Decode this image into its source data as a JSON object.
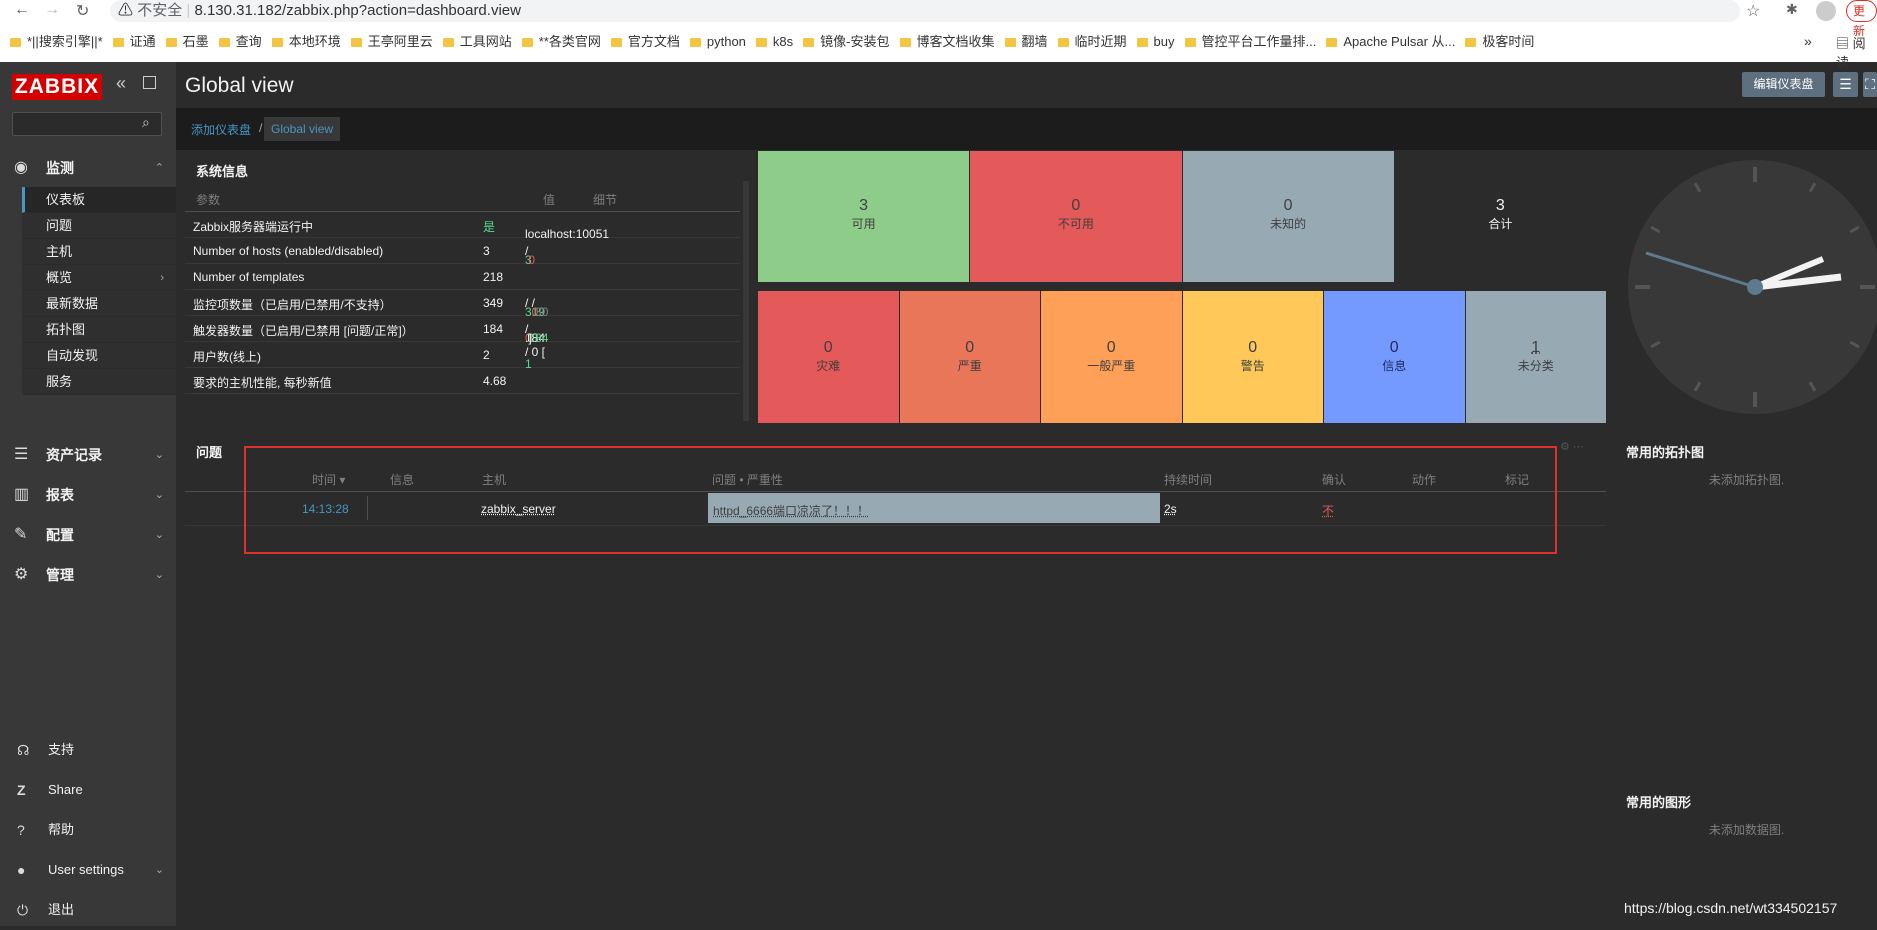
{
  "browser": {
    "insecure_label": "不安全",
    "url": "8.130.31.182/zabbix.php?action=dashboard.view",
    "bookmarks": [
      "*||搜索引擎||*",
      "证通",
      "石墨",
      "查询",
      "本地环境",
      "王亭阿里云",
      "工具网站",
      "**各类官网",
      "官方文档",
      "python",
      "k8s",
      "镜像-安装包",
      "博客文档收集",
      "翻墙",
      "临时近期",
      "buy",
      "管控平台工作量排...",
      "Apache Pulsar 从...",
      "极客时间"
    ],
    "more_label": "»",
    "reading_list": "阅读",
    "update_button": "更新"
  },
  "sidebar": {
    "logo": "ZABBIX",
    "search_placeholder": "",
    "menus": [
      {
        "label": "监测",
        "icon": "eye-icon"
      },
      {
        "label": "资产记录",
        "icon": "list-icon"
      },
      {
        "label": "报表",
        "icon": "chart-icon"
      },
      {
        "label": "配置",
        "icon": "wrench-icon"
      },
      {
        "label": "管理",
        "icon": "gear-icon"
      }
    ],
    "monitor_items": [
      "仪表板",
      "问题",
      "主机",
      "概览",
      "最新数据",
      "拓扑图",
      "自动发现",
      "服务"
    ],
    "footer": [
      "支持",
      "Share",
      "帮助",
      "User settings",
      "退出"
    ]
  },
  "header": {
    "title": "Global view",
    "edit_button": "编辑仪表盘",
    "breadcrumb": [
      "添加仪表盘",
      "Global view"
    ],
    "breadcrumb_sep": "/"
  },
  "system_info": {
    "title": "系统信息",
    "headers": [
      "参数",
      "值",
      "细节"
    ],
    "rows": [
      {
        "param": "Zabbix服务器端运行中",
        "value": "是",
        "detail": "localhost:10051"
      },
      {
        "param": "Number of hosts (enabled/disabled)",
        "value": "3",
        "d1": "3",
        "d2": "0"
      },
      {
        "param": "Number of templates",
        "value": "218"
      },
      {
        "param": "监控项数量（已启用/已禁用/不支持）",
        "value": "349",
        "d1": "319",
        "d2": "0",
        "d3": "30"
      },
      {
        "param": "触发器数量（已启用/已禁用 [问题/正常]）",
        "value": "184",
        "d0": "184 / 0 [",
        "d2": "0",
        "d3": "184",
        "dend": "]"
      },
      {
        "param": "用户数(线上)",
        "value": "2",
        "d1": "1"
      },
      {
        "param": "要求的主机性能, 每秒新值",
        "value": "4.68"
      }
    ],
    "sep": " / "
  },
  "host_availability": [
    {
      "count": "3",
      "label": "可用",
      "color": "#8ecc8a"
    },
    {
      "count": "0",
      "label": "不可用",
      "color": "#e45959"
    },
    {
      "count": "0",
      "label": "未知的",
      "color": "#97aab3"
    },
    {
      "count": "3",
      "label": "合计",
      "color": "#2b2b2b"
    }
  ],
  "severity": [
    {
      "count": "0",
      "label": "灾难",
      "color": "#e45959"
    },
    {
      "count": "0",
      "label": "严重",
      "color": "#e97659"
    },
    {
      "count": "0",
      "label": "一般严重",
      "color": "#ffa059"
    },
    {
      "count": "0",
      "label": "警告",
      "color": "#ffc859"
    },
    {
      "count": "0",
      "label": "信息",
      "color": "#7499ff"
    },
    {
      "count": "1",
      "label": "未分类",
      "color": "#97aab3"
    }
  ],
  "problems": {
    "title": "问题",
    "headers": [
      "时间 ▾",
      "信息",
      "主机",
      "问题 • 严重性",
      "持续时间",
      "确认",
      "动作",
      "标记"
    ],
    "row": {
      "time": "14:13:28",
      "host": "zabbix_server",
      "problem": "httpd_6666端口凉凉了！！！",
      "duration": "2s",
      "ack": "不"
    }
  },
  "favorite_maps": {
    "title": "常用的拓扑图",
    "empty": "未添加拓扑图."
  },
  "favorite_graphs": {
    "title": "常用的图形",
    "empty": "未添加数据图."
  },
  "watermark": "https://blog.csdn.net/wt334502157"
}
